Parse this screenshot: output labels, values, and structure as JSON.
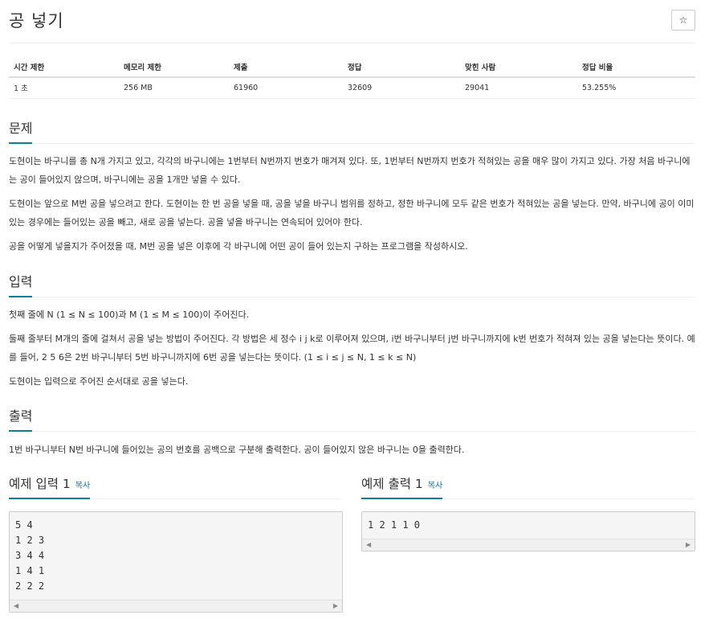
{
  "header": {
    "title": "공 넣기",
    "star_icon": "☆"
  },
  "info_table": {
    "headers": [
      "시간 제한",
      "메모리 제한",
      "제출",
      "정답",
      "맞힌 사람",
      "정답 비율"
    ],
    "values": [
      "1 초",
      "256 MB",
      "61960",
      "32609",
      "29041",
      "53.255%"
    ]
  },
  "problem": {
    "title": "문제",
    "paragraphs": [
      "도현이는 바구니를 총 N개 가지고 있고, 각각의 바구니에는 1번부터 N번까지 번호가 매겨져 있다. 또, 1번부터 N번까지 번호가 적혀있는 공을 매우 많이 가지고 있다. 가장 처음 바구니에는 공이 들어있지 않으며, 바구니에는 공을 1개만 넣을 수 있다.",
      "도현이는 앞으로 M번 공을 넣으려고 한다. 도현이는 한 번 공을 넣을 때, 공을 넣을 바구니 범위를 정하고, 정한 바구니에 모두 같은 번호가 적혀있는 공을 넣는다. 만약, 바구니에 공이 이미 있는 경우에는 들어있는 공을 빼고, 새로 공을 넣는다. 공을 넣을 바구니는 연속되어 있어야 한다.",
      "공을 어떻게 넣을지가 주어졌을 때, M번 공을 넣은 이후에 각 바구니에 어떤 공이 들어 있는지 구하는 프로그램을 작성하시오."
    ]
  },
  "input": {
    "title": "입력",
    "paragraphs": [
      "첫째 줄에 N (1 ≤ N ≤ 100)과 M (1 ≤ M ≤ 100)이 주어진다.",
      "둘째 줄부터 M개의 줄에 걸쳐서 공을 넣는 방법이 주어진다. 각 방법은 세 정수 i j k로 이루어져 있으며, i번 바구니부터 j번 바구니까지에 k번 번호가 적혀져 있는 공을 넣는다는 뜻이다. 예를 들어, 2 5 6은 2번 바구니부터 5번 바구니까지에 6번 공을 넣는다는 뜻이다. (1 ≤ i ≤ j ≤ N, 1 ≤ k ≤ N)",
      "도현이는 입력으로 주어진 순서대로 공을 넣는다."
    ]
  },
  "output": {
    "title": "출력",
    "paragraphs": [
      "1번 바구니부터 N번 바구니에 들어있는 공의 번호를 공백으로 구분해 출력한다. 공이 들어있지 않은 바구니는 0을 출력한다."
    ]
  },
  "sample_input": {
    "title": "예제 입력 1",
    "copy_label": "복사",
    "content": "5 4\n1 2 3\n3 4 4\n1 4 1\n2 2 2"
  },
  "sample_output": {
    "title": "예제 출력 1",
    "copy_label": "복사",
    "content": "1 2 1 1 0"
  },
  "colors": {
    "accent": "#0e7f99",
    "link": "#0076c0",
    "code_bg": "#f5f5f5"
  }
}
